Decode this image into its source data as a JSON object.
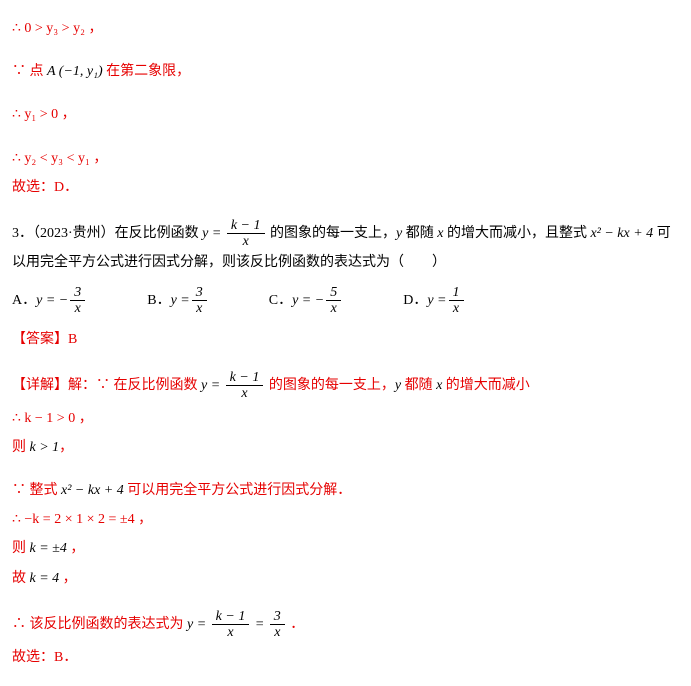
{
  "lines": {
    "l1": "∴ 0 > y₃ > y₂ ，",
    "l2_prefix": "∵ 点 ",
    "l2_point": "A (−1, y₁)",
    "l2_suffix": " 在第二象限，",
    "l3": "∴ y₁ > 0 ，",
    "l4": "∴ y₂ < y₃ < y₁ ，",
    "l5": "故选：D．",
    "q_num": "3．（2023·贵州）在反比例函数 ",
    "q_eq_lhs": "y = ",
    "q_frac_num": "k − 1",
    "q_frac_den": "x",
    "q_mid1": " 的图象的每一支上，",
    "q_mid_y": "y",
    "q_mid2": " 都随 ",
    "q_mid_x": "x",
    "q_mid3": " 的增大而减小，且整式 ",
    "q_poly": "x² − kx + 4",
    "q_suffix": " 可以用完全平方公式进行因式分解，则该反比例函数的表达式为（　　）",
    "optA_label": "A．",
    "optA_eq": "y = −",
    "optA_num": "3",
    "optA_den": "x",
    "optB_label": "B．",
    "optB_eq": "y = ",
    "optB_num": "3",
    "optB_den": "x",
    "optC_label": "C．",
    "optC_eq": "y = −",
    "optC_num": "5",
    "optC_den": "x",
    "optD_label": "D．",
    "optD_eq": "y = ",
    "optD_num": "1",
    "optD_den": "x",
    "ans_label": "【答案】B",
    "detail_prefix": "【详解】解：∵ 在反比例函数 ",
    "detail_eq_lhs": "y = ",
    "detail_num": "k − 1",
    "detail_den": "x",
    "detail_mid1": " 的图象的每一支上，",
    "detail_y": "y",
    "detail_mid2": " 都随 ",
    "detail_x": "x",
    "detail_mid3": " 的增大而减小",
    "s1": "∴ k − 1 > 0 ，",
    "s2_pre": "则 ",
    "s2_math": "k > 1",
    "s2_suf": "，",
    "s3_pre": "∵ 整式 ",
    "s3_poly": "x² − kx + 4",
    "s3_suf": " 可以用完全平方公式进行因式分解．",
    "s4": "∴ −k = 2 × 1 × 2 = ±4 ，",
    "s5_pre": "则 ",
    "s5_math": "k = ±4",
    "s5_suf": " ，",
    "s6_pre": "故 ",
    "s6_math": "k = 4",
    "s6_suf": " ，",
    "s7_pre": "∴ 该反比例函数的表达式为 ",
    "s7_lhs": "y = ",
    "s7_num1": "k − 1",
    "s7_den1": "x",
    "s7_mid": " = ",
    "s7_num2": "3",
    "s7_den2": "x",
    "s7_suf": " ．",
    "s8": "故选：B．"
  }
}
